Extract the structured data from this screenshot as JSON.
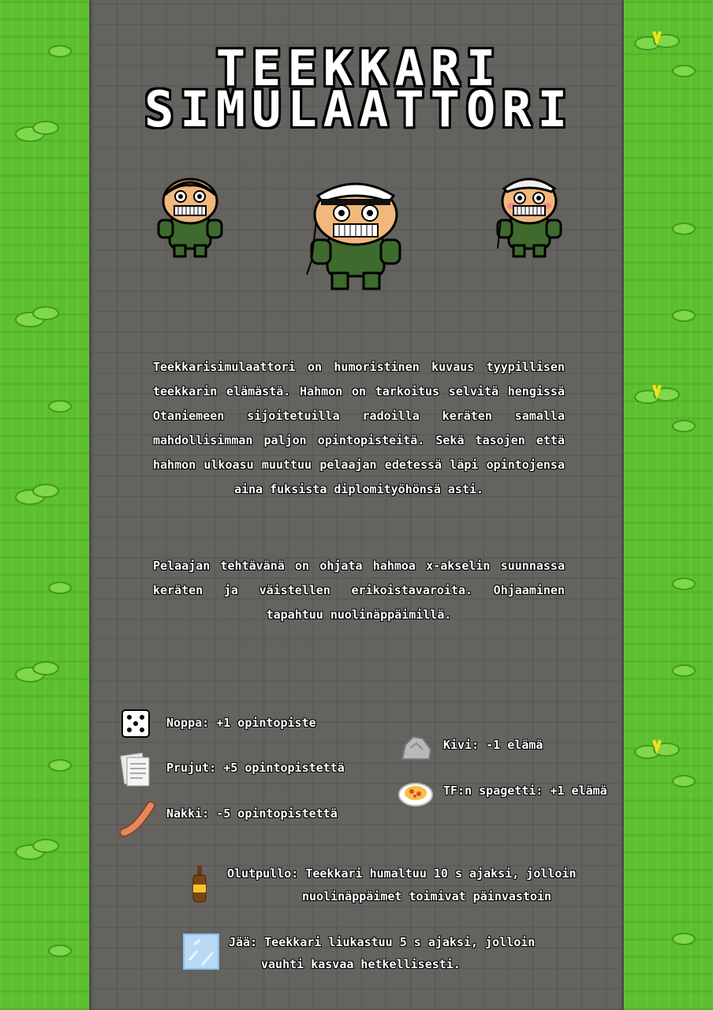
{
  "title_line1": "TEEKKARI",
  "title_line2": "SIMULAATTORI",
  "paragraph1": "Teekkarisimulaattori on humoristinen kuvaus tyypillisen teekkarin elämästä. Hahmon on tarkoitus selvitä hengissä Otaniemeen sijoitetuilla radoilla keräten samalla mahdollisimman paljon opintopisteitä. Sekä tasojen että hahmon ulkoasu muuttuu pelaajan edetessä läpi opintojensa aina fuksista diplomityöhönsä asti.",
  "paragraph2": "Pelaajan tehtävänä on ohjata hahmoa x-akselin suunnassa keräten ja väistellen erikoistavaroita. Ohjaaminen tapahtuu nuolinäppäimillä.",
  "items": {
    "noppa": "Noppa: +1 opintopiste",
    "prujut": "Prujut: +5 opintopistettä",
    "nakki": "Nakki: -5 opintopistettä",
    "kivi": "Kivi: -1 elämä",
    "spagetti": "TF:n spagetti: +1 elämä",
    "olutpullo_line1": "Olutpullo: Teekkari humaltuu 10 s ajaksi, jolloin",
    "olutpullo_line2": "nuolinäppäimet toimivat päinvastoin",
    "jaa_line1": "Jää: Teekkari liukastuu 5 s ajaksi, jolloin",
    "jaa_line2": "vauhti kasvaa hetkellisesti."
  },
  "colors": {
    "grass": "#5cc02e",
    "road": "#646360",
    "jacket": "#3e6a2e",
    "text": "#ffffff"
  }
}
